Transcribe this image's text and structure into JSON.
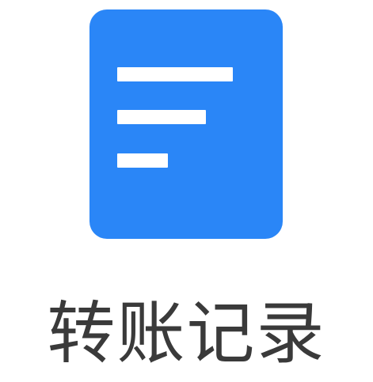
{
  "tile": {
    "label": "转账记录",
    "icon": "document-list-icon",
    "accent_color": "#2a86f7",
    "label_color": "#3a3a3a"
  }
}
